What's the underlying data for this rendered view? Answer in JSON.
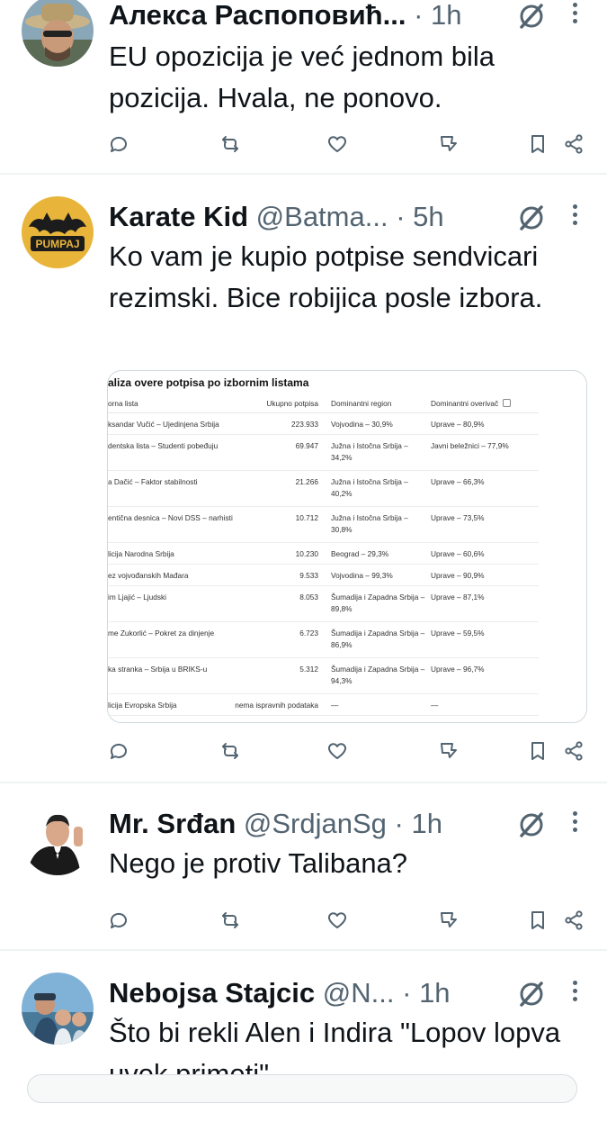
{
  "tweets": [
    {
      "name": "Алекса Распоповић...",
      "handle": "",
      "dot": "·",
      "time": "1h",
      "text": "EU opozicija je već jednom bila pozicija. Hvala, ne ponovo.",
      "avatar": "avatar-man-with-hat"
    },
    {
      "name": "Karate Kid",
      "handle": "@Batma...",
      "dot": "·",
      "time": "5h",
      "text": "Ko vam je kupio potpise sendvicari rezimski. Bice robijica posle izbora.",
      "avatar": "avatar-batman-pumpaj",
      "avatar_text": "PUMPAJ"
    },
    {
      "name": "Mr. Srđan",
      "handle": "@SrdjanSg",
      "dot": "·",
      "time": "1h",
      "text": "Nego je protiv Talibana?",
      "avatar": "avatar-man-in-tuxedo"
    },
    {
      "name": "Nebojsa Stajcic",
      "handle": "@N...",
      "dot": "·",
      "time": "1h",
      "text": "Što bi rekli Alen i Indira \"Lopov lopva uvek primeti\"",
      "avatar": "avatar-family-photo"
    }
  ],
  "media_table": {
    "title": "aliza overe potpisa po izbornim listama",
    "headers": [
      "orna lista",
      "Ukupno potpisa",
      "Dominantni region",
      "Dominantni overivač"
    ],
    "rows": [
      [
        "ksandar Vučić – Ujedinjena Srbija",
        "223.933",
        "Vojvodina – 30,9%",
        "Uprave – 80,9%"
      ],
      [
        "dentska lista – Studenti pobeđuju",
        "69.947",
        "Južna i Istočna Srbija – 34,2%",
        "Javni beležnici – 77,9%"
      ],
      [
        "a Dačić – Faktor stabilnosti",
        "21.266",
        "Južna i Istočna Srbija – 40,2%",
        "Uprave – 66,3%"
      ],
      [
        "entična desnica – Novi DSS – narhisti",
        "10.712",
        "Južna i Istočna Srbija – 30,8%",
        "Uprave – 73,5%"
      ],
      [
        "licija Narodna Srbija",
        "10.230",
        "Beograd – 29,3%",
        "Uprave – 60,6%"
      ],
      [
        "ez vojvođanskih Mađara",
        "9.533",
        "Vojvodina – 99,3%",
        "Uprave – 90,9%"
      ],
      [
        "im Ljajić – Ljudski",
        "8.053",
        "Šumadija i Zapadna Srbija – 89,8%",
        "Uprave – 87,1%"
      ],
      [
        "me Zukorlić – Pokret za dinjenje",
        "6.723",
        "Šumadija i Zapadna Srbija – 86,9%",
        "Uprave – 59,5%"
      ],
      [
        "ka stranka – Srbija u BRIKS-u",
        "5.312",
        "Šumadija i Zapadna Srbija – 94,3%",
        "Uprave – 96,7%"
      ],
      [
        "licija Evropska Srbija",
        "nema ispravnih podataka",
        "—",
        "—"
      ]
    ]
  },
  "icons": {
    "actions": [
      "reply-icon",
      "repost-icon",
      "like-icon",
      "views-icon",
      "bookmark-icon",
      "share-icon"
    ],
    "header": [
      "grok-icon",
      "more-icon"
    ]
  },
  "colors": {
    "text": "#0f1419",
    "secondary": "#536471",
    "divider": "#eff3f4",
    "pumpaj_yellow": "#e8b53a"
  }
}
